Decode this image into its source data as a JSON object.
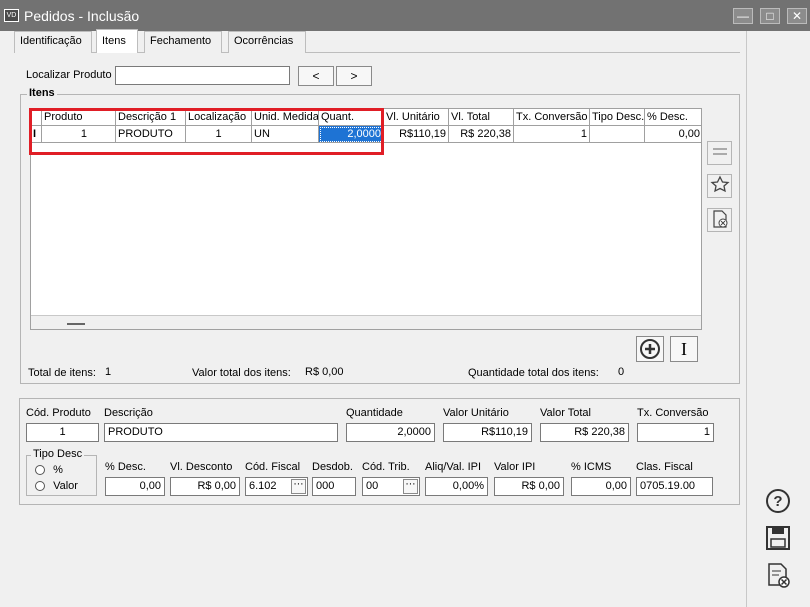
{
  "window": {
    "title": "Pedidos - Inclusão",
    "icon_text": "VD"
  },
  "tabs": [
    {
      "label": "Identificação"
    },
    {
      "label": "Itens"
    },
    {
      "label": "Fechamento"
    },
    {
      "label": "Ocorrências"
    }
  ],
  "search": {
    "label": "Localizar Produto",
    "value": "",
    "prev": "<",
    "next": ">"
  },
  "items_group": {
    "title": "Itens"
  },
  "grid": {
    "columns": [
      "Produto",
      "Descrição 1",
      "Localização",
      "Unid. Medida",
      "Quant.",
      "Vl. Unitário",
      "Vl. Total",
      "Tx. Conversão",
      "Tipo Desc.",
      "% Desc."
    ],
    "row": {
      "indicator": "I",
      "produto": "1",
      "descricao": "PRODUTO",
      "localizacao": "1",
      "unidade": "UN",
      "quant": "2,0000",
      "vl_unitario": "R$110,19",
      "vl_total": "R$ 220,38",
      "tx_conversao": "1",
      "tipo_desc": "",
      "pct_desc": "0,00"
    }
  },
  "totals": {
    "total_itens_label": "Total de itens:",
    "total_itens_value": "1",
    "valor_total_label": "Valor total dos itens:",
    "valor_total_value": "R$ 0,00",
    "qtd_total_label": "Quantidade total dos itens:",
    "qtd_total_value": "0"
  },
  "detail": {
    "cod_produto_label": "Cód. Produto",
    "cod_produto": "1",
    "descricao_label": "Descrição",
    "descricao": "PRODUTO",
    "quantidade_label": "Quantidade",
    "quantidade": "2,0000",
    "valor_unitario_label": "Valor Unitário",
    "valor_unitario": "R$110,19",
    "valor_total_label": "Valor Total",
    "valor_total": "R$ 220,38",
    "tx_conversao_label": "Tx. Conversão",
    "tx_conversao": "1",
    "tipo_desc_label": "Tipo Desc",
    "tipo_pct": "%",
    "tipo_valor": "Valor",
    "pct_desc_label": "% Desc.",
    "pct_desc": "0,00",
    "vl_desconto_label": "Vl. Desconto",
    "vl_desconto": "R$ 0,00",
    "cod_fiscal_label": "Cód. Fiscal",
    "cod_fiscal": "6.102",
    "desdob_label": "Desdob.",
    "desdob": "000",
    "cod_trib_label": "Cód. Trib.",
    "cod_trib": "00",
    "aliq_ipi_label": "Aliq/Val. IPI",
    "aliq_ipi": "0,00%",
    "valor_ipi_label": "Valor IPI",
    "valor_ipi": "R$ 0,00",
    "pct_icms_label": "% ICMS",
    "pct_icms": "0,00",
    "clas_fiscal_label": "Clas. Fiscal",
    "clas_fiscal": "0705.19.00"
  },
  "icons": {
    "help": "help-icon",
    "save": "save-icon",
    "cancel": "cancel-doc-icon",
    "add": "add-icon",
    "insert": "insert-icon"
  },
  "colors": {
    "titlebar": "#727272",
    "selection": "#1e73d4",
    "highlight": "#e01e26"
  }
}
